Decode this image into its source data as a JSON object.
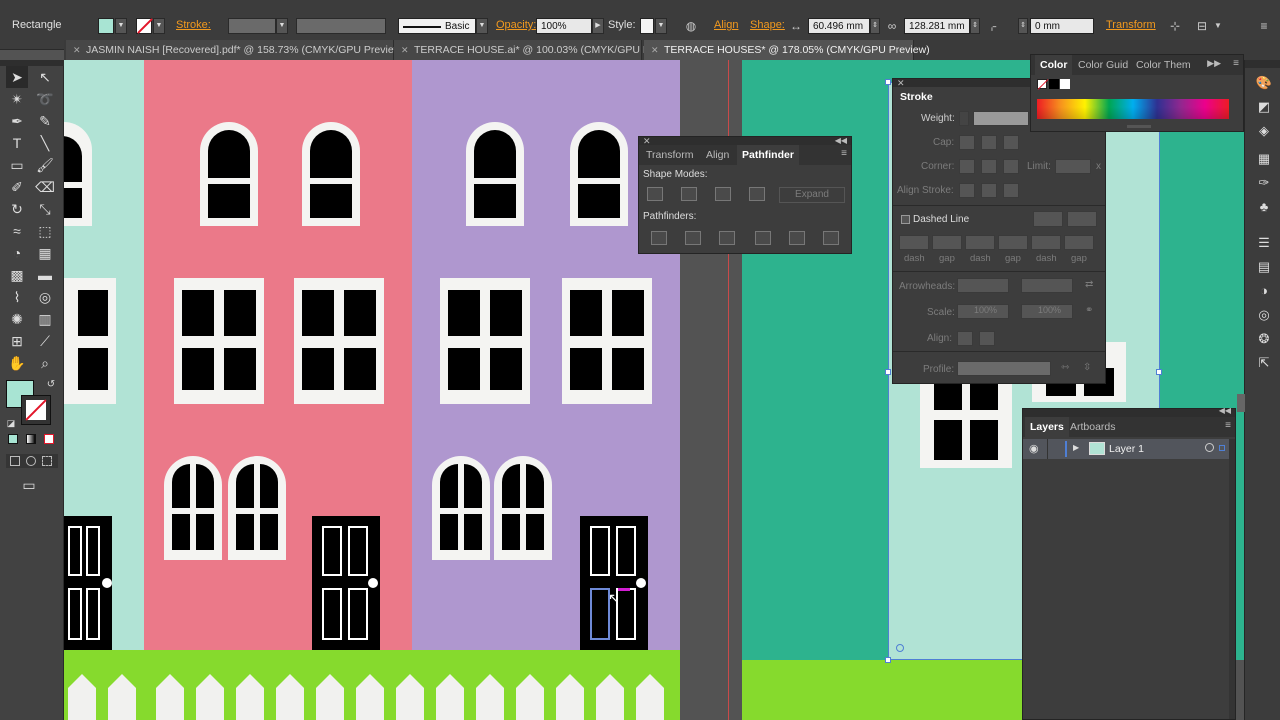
{
  "control_bar": {
    "selection_type": "Rectangle",
    "stroke_label": "Stroke:",
    "stroke_weight": "",
    "brush_profile": "Basic",
    "opacity_label": "Opacity:",
    "opacity_value": "100%",
    "style_label": "Style:",
    "align_label": "Align",
    "shape_label": "Shape:",
    "width_value": "60.496 mm",
    "height_value": "128.281 mm",
    "corner_value": "0 mm",
    "transform_label": "Transform",
    "fill_color": "#a8e4d3"
  },
  "tabs": [
    {
      "label": "JASMIN NAISH [Recovered].pdf* @ 158.73% (CMYK/GPU Preview)"
    },
    {
      "label": "TERRACE HOUSE.ai* @ 100.03% (CMYK/GPU Preview)"
    },
    {
      "label": "TERRACE HOUSES* @ 178.05% (CMYK/GPU Preview)"
    }
  ],
  "tools_panel": {
    "icons": [
      "selection-tool",
      "direct-selection-tool",
      "magic-wand-tool",
      "lasso-tool",
      "pen-tool",
      "curvature-tool",
      "type-tool",
      "line-segment-tool",
      "rectangle-tool",
      "paintbrush-tool",
      "shaper-tool",
      "eraser-tool",
      "rotate-tool",
      "scale-tool",
      "width-tool",
      "free-transform-tool",
      "shape-builder-tool",
      "perspective-grid-tool",
      "mesh-tool",
      "gradient-tool",
      "eyedropper-tool",
      "blend-tool",
      "symbol-sprayer-tool",
      "column-graph-tool",
      "artboard-tool",
      "slice-tool",
      "hand-tool",
      "zoom-tool"
    ],
    "fill_swatch_color": "#a8e4d3"
  },
  "pathfinder_panel": {
    "tabs": [
      "Transform",
      "Align",
      "Pathfinder"
    ],
    "active_tab": "Pathfinder",
    "shape_modes_label": "Shape Modes:",
    "expand_label": "Expand",
    "pathfinders_label": "Pathfinders:"
  },
  "stroke_panel": {
    "title": "Stroke",
    "weight_label": "Weight:",
    "cap_label": "Cap:",
    "corner_label": "Corner:",
    "limit_label": "Limit:",
    "limit_suffix": "x",
    "align_stroke_label": "Align Stroke:",
    "dashed_line_label": "Dashed Line",
    "dash_labels": [
      "dash",
      "gap",
      "dash",
      "gap",
      "dash",
      "gap"
    ],
    "arrowheads_label": "Arrowheads:",
    "scale_label": "Scale:",
    "scale_values": [
      "100%",
      "100%"
    ],
    "align_label": "Align:",
    "profile_label": "Profile:"
  },
  "color_panel": {
    "tabs": [
      "Color",
      "Color Guid",
      "Color Them"
    ],
    "active_tab": "Color"
  },
  "layers_panel": {
    "tabs": [
      "Layers",
      "Artboards"
    ],
    "active_tab": "Layers",
    "layers": [
      {
        "name": "Layer 1"
      }
    ]
  },
  "colors": {
    "mint": "#b1e3d5",
    "pink": "#eb7989",
    "lavender": "#af97cf",
    "grass": "#86da2d",
    "teal": "#2db38e",
    "picket": "#f1f1ef",
    "selection": "#4f7fd4"
  }
}
